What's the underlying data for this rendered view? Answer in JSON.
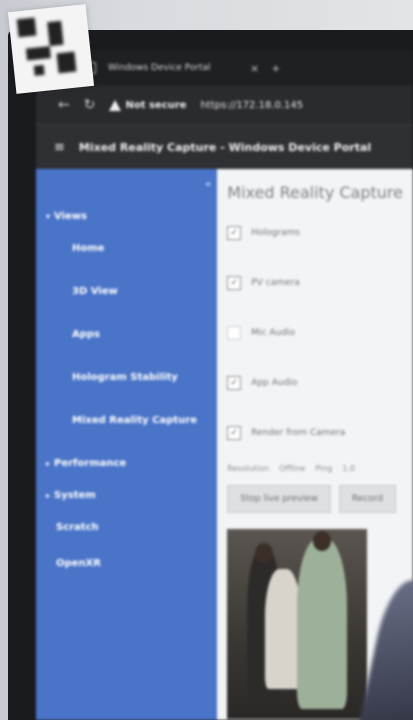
{
  "browser": {
    "tab_title": "Windows Device Portal",
    "tab_close": "×",
    "tab_new": "+",
    "not_secure_label": "Not secure",
    "url": "https://172.18.0.145"
  },
  "header": {
    "menu_glyph": "≡",
    "title": "Mixed Reality Capture - Windows Device Portal"
  },
  "sidebar": {
    "collapse_glyph": "«",
    "groups": [
      {
        "label": "Views",
        "expanded": true
      },
      {
        "label": "Performance",
        "expanded": false
      },
      {
        "label": "System",
        "expanded": false
      }
    ],
    "views_items": [
      {
        "label": "Home"
      },
      {
        "label": "3D View"
      },
      {
        "label": "Apps"
      },
      {
        "label": "Hologram Stability"
      },
      {
        "label": "Mixed Reality Capture"
      }
    ],
    "top_items": [
      {
        "label": "Scratch"
      },
      {
        "label": "OpenXR"
      }
    ],
    "caret_expanded": "▾",
    "caret_collapsed": "▸"
  },
  "main": {
    "title": "Mixed Reality Capture",
    "settings": [
      {
        "label": "Holograms",
        "checked": true,
        "mark": "✓"
      },
      {
        "label": "PV camera",
        "checked": true,
        "mark": "✓"
      },
      {
        "label": "Mic Audio",
        "checked": false,
        "mark": ""
      },
      {
        "label": "App Audio",
        "checked": true,
        "mark": "✓"
      },
      {
        "label": "Render from Camera",
        "checked": true,
        "mark": "✓"
      }
    ],
    "links": [
      "Resolution",
      "Offline",
      "Ping",
      "1.0"
    ],
    "buttons": {
      "stop_preview": "Stop live preview",
      "secondary": "Record"
    }
  },
  "colors": {
    "sidebar_bg": "#4a74c8",
    "header_bg": "#2f3033",
    "main_bg": "#f3f4f6"
  }
}
